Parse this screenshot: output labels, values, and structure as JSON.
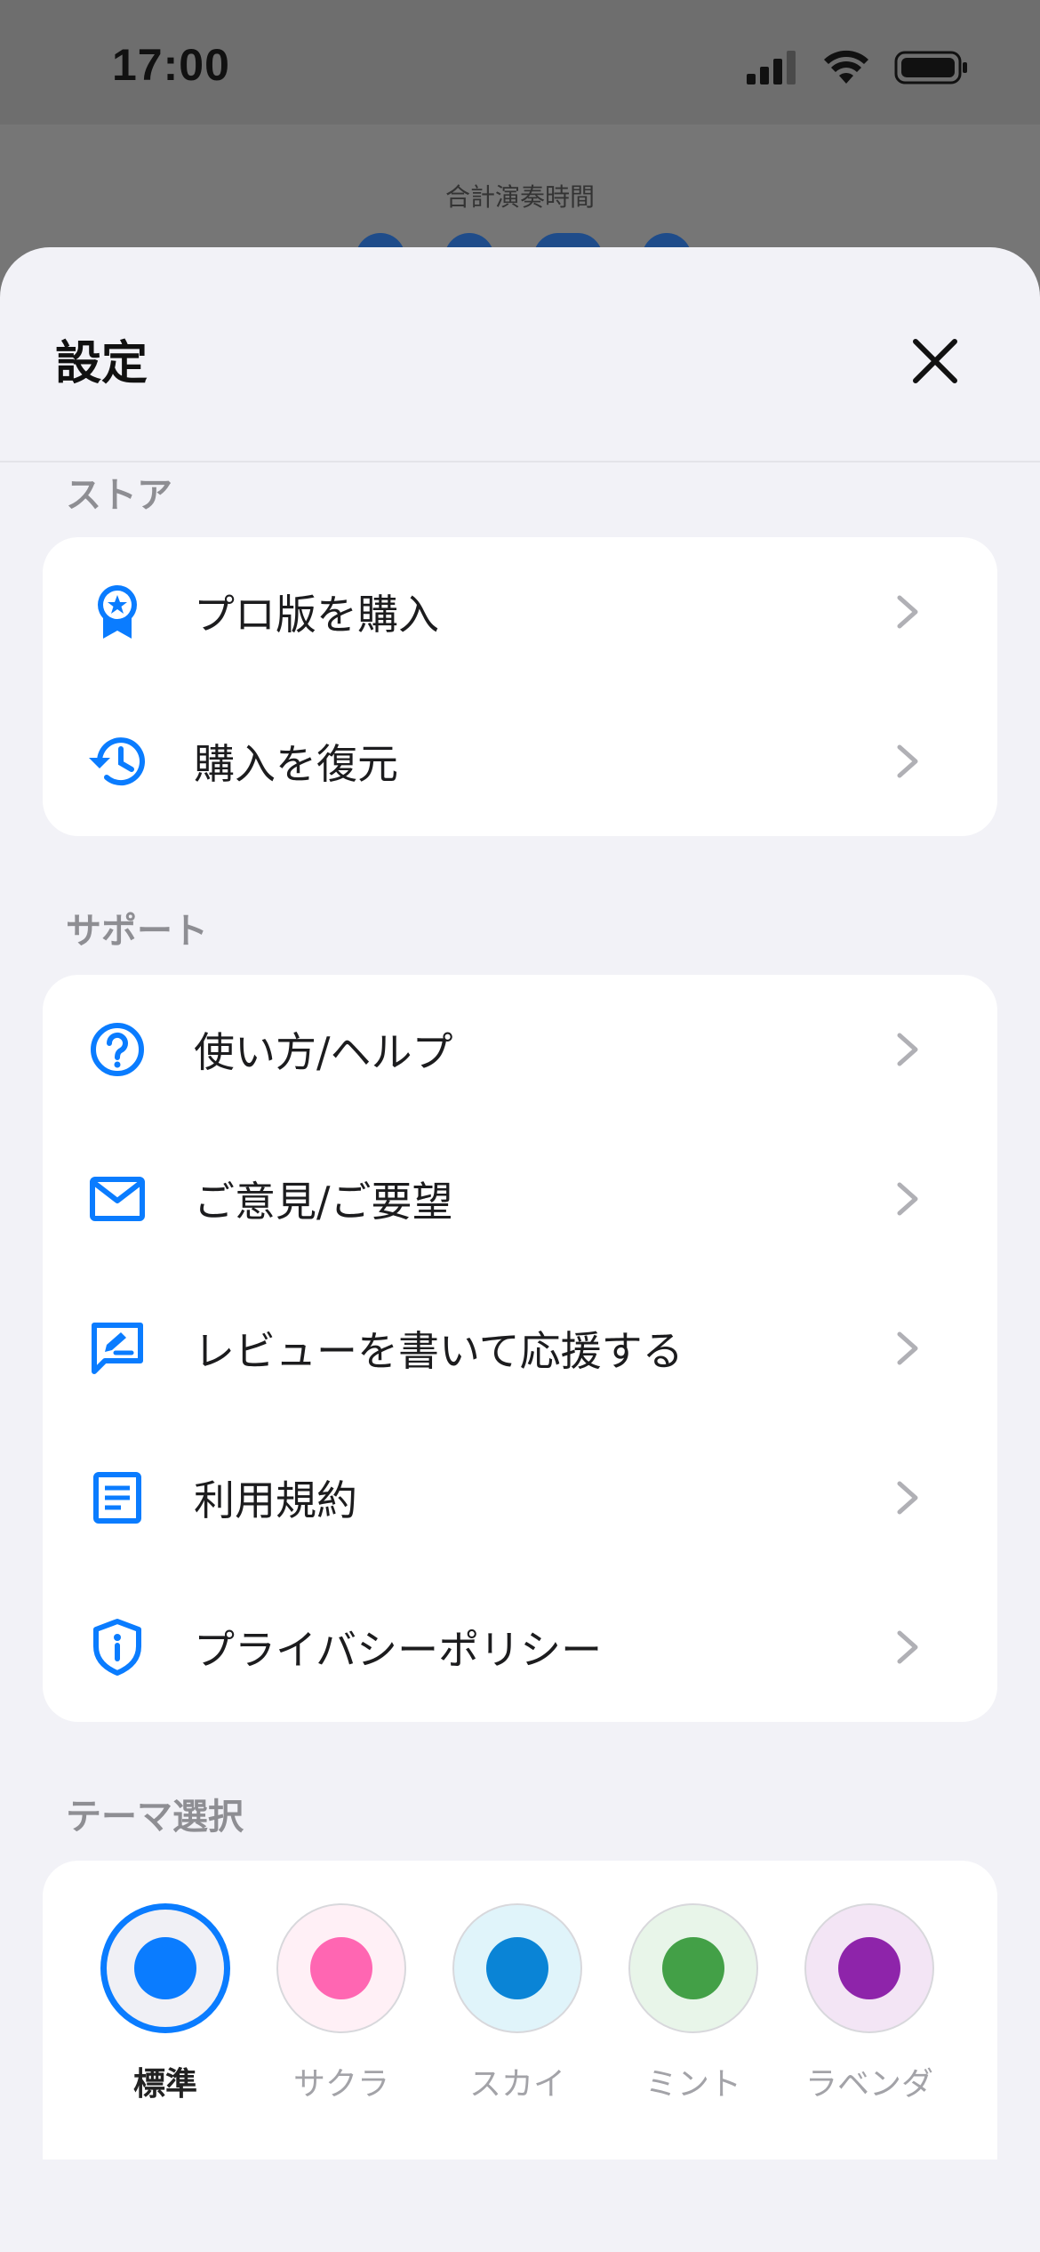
{
  "status": {
    "time": "17:00"
  },
  "background": {
    "label": "合計演奏時間"
  },
  "sheet": {
    "title": "設定"
  },
  "sections": {
    "store": {
      "label": "ストア",
      "items": [
        {
          "label": "プロ版を購入",
          "icon": "award-ribbon-icon"
        },
        {
          "label": "購入を復元",
          "icon": "history-restore-icon"
        }
      ]
    },
    "support": {
      "label": "サポート",
      "items": [
        {
          "label": "使い方/ヘルプ",
          "icon": "help-circle-icon"
        },
        {
          "label": "ご意見/ご要望",
          "icon": "mail-icon"
        },
        {
          "label": "レビューを書いて応援する",
          "icon": "review-edit-icon"
        },
        {
          "label": "利用規約",
          "icon": "document-icon"
        },
        {
          "label": "プライバシーポリシー",
          "icon": "shield-info-icon"
        }
      ]
    },
    "theme": {
      "label": "テーマ選択",
      "options": [
        {
          "name": "標準",
          "color": "#0a7cff",
          "bg": "#f0f0f5",
          "selected": true
        },
        {
          "name": "サクラ",
          "color": "#ff66b2",
          "bg": "#fff0f6",
          "selected": false
        },
        {
          "name": "スカイ",
          "color": "#0a84d6",
          "bg": "#e0f4fa",
          "selected": false
        },
        {
          "name": "ミント",
          "color": "#43a047",
          "bg": "#e8f5e9",
          "selected": false
        },
        {
          "name": "ラベンダ",
          "color": "#8e24aa",
          "bg": "#f3e5f5",
          "selected": false
        }
      ],
      "row2_colors": [
        "#fff8e8",
        "#fdf3e2",
        "#fdecee",
        "#111111",
        "#b8860b"
      ]
    }
  },
  "colors": {
    "accent": "#0a7cff",
    "chevron": "#b0b0b5",
    "sheet_bg": "#f2f2f7"
  }
}
